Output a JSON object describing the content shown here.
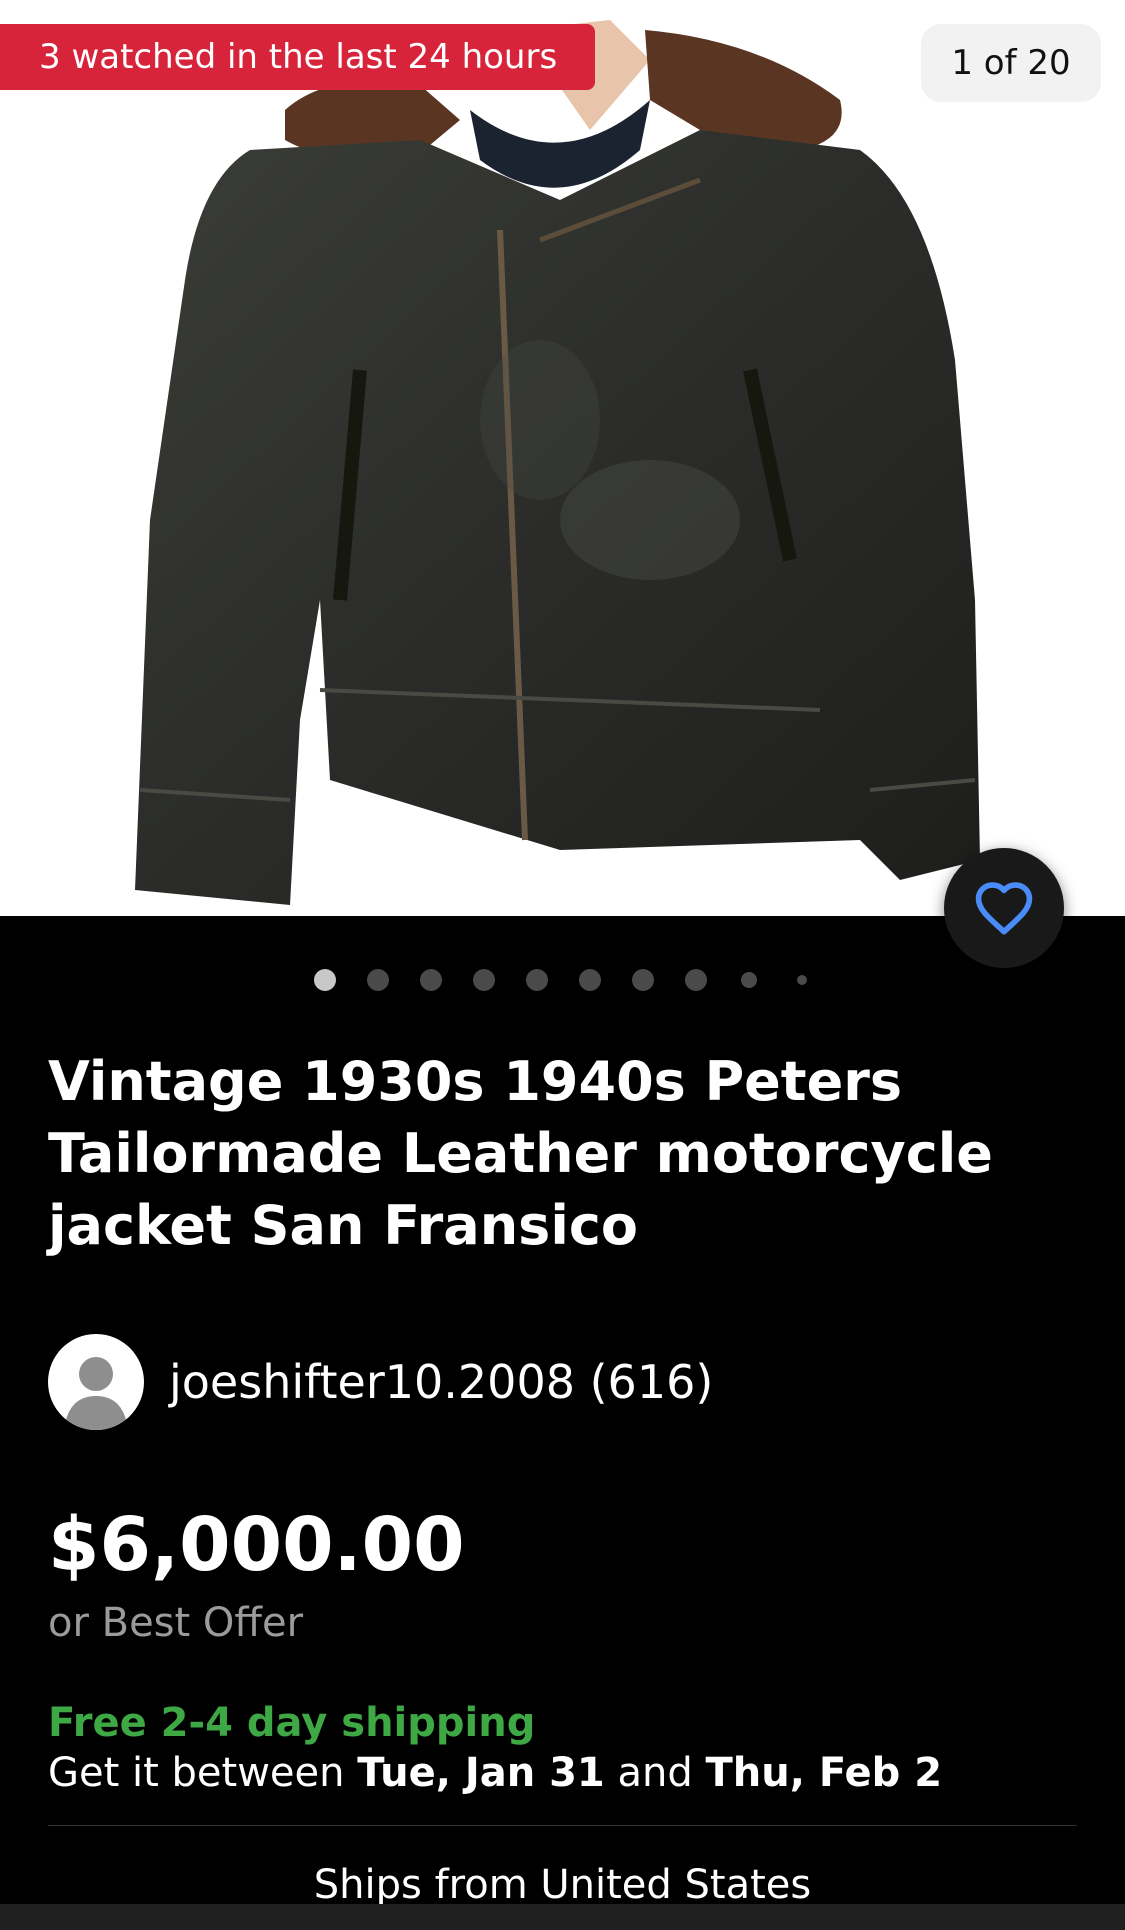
{
  "image": {
    "watched_badge": "3 watched in the last 24 hours",
    "counter": "1 of 20",
    "watch_icon": "heart-icon",
    "carousel_dot_count": 10,
    "active_index": 0
  },
  "listing": {
    "title": "Vintage 1930s 1940s Peters Tailormade Leather motorcycle jacket San Fransico",
    "seller_name": "joeshifter10.2008",
    "seller_feedback": "(616)",
    "price": "$6,000.00",
    "best_offer": "or Best Offer"
  },
  "shipping": {
    "headline": "Free 2-4 day shipping",
    "get_it_between": "Get it between",
    "start_date": "Tue, Jan 31",
    "and": "and",
    "end_date": "Thu, Feb 2",
    "ships_from": "Ships from United States"
  },
  "colors": {
    "badge": "#d8243b",
    "shipping_green": "#3ea845",
    "heart_blue": "#4a8cf7",
    "background": "#000000"
  }
}
